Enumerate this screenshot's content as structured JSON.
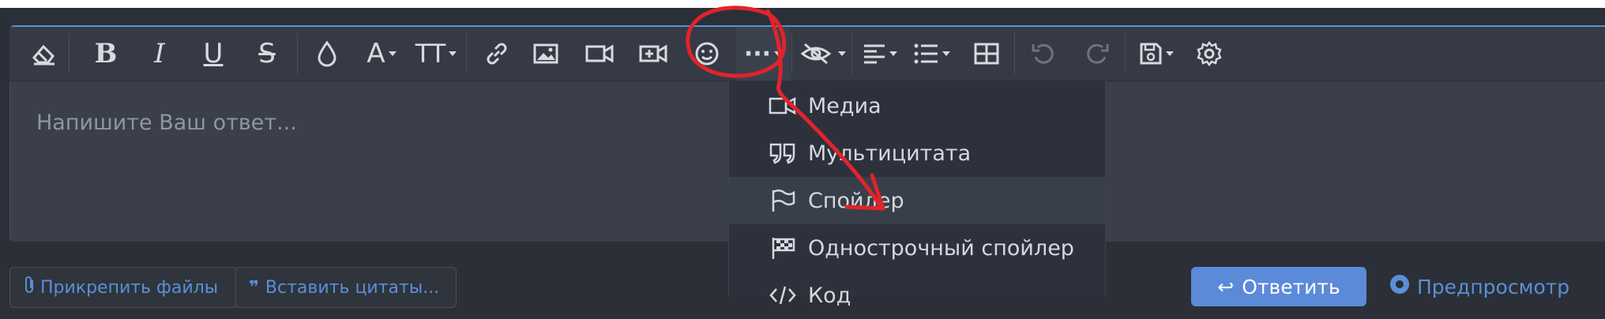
{
  "editor": {
    "placeholder": "Напишите Ваш ответ..."
  },
  "toolbar": {
    "buttons": [
      {
        "name": "clear-formatting",
        "icon": "eraser-icon"
      },
      {
        "name": "bold",
        "label": "B"
      },
      {
        "name": "italic",
        "label": "I"
      },
      {
        "name": "underline",
        "label": "U"
      },
      {
        "name": "strikethrough",
        "label": "S"
      },
      {
        "name": "text-color",
        "icon": "drop-icon"
      },
      {
        "name": "font-family",
        "label": "A"
      },
      {
        "name": "font-size",
        "label": "TT"
      },
      {
        "name": "link",
        "icon": "link-icon"
      },
      {
        "name": "image",
        "icon": "image-icon"
      },
      {
        "name": "video",
        "icon": "video-icon"
      },
      {
        "name": "insert-media",
        "icon": "video-plus-icon"
      },
      {
        "name": "emoji",
        "icon": "smile-icon"
      },
      {
        "name": "more",
        "label": "···"
      },
      {
        "name": "hide",
        "icon": "eye-slash-icon"
      },
      {
        "name": "align",
        "icon": "align-left-icon"
      },
      {
        "name": "list",
        "icon": "list-icon"
      },
      {
        "name": "table",
        "icon": "table-icon"
      },
      {
        "name": "undo",
        "icon": "undo-icon"
      },
      {
        "name": "redo",
        "icon": "redo-icon"
      },
      {
        "name": "drafts",
        "icon": "floppy-icon"
      },
      {
        "name": "settings",
        "icon": "gear-icon"
      }
    ]
  },
  "more_menu": {
    "items": [
      "Медиа",
      "Мультицитата",
      "Спойлер",
      "Однострочный спойлер",
      "Код"
    ]
  },
  "footer": {
    "attach_label": "Прикрепить файлы",
    "insert_quotes_label": "Вставить цитаты...",
    "reply_label": "Ответить",
    "preview_label": "Предпросмотр"
  },
  "colors": {
    "accent": "#5b8fd6",
    "annotation": "#e0242b",
    "menu_bg": "#2c313b",
    "editor_bg": "#3a3f4a"
  }
}
